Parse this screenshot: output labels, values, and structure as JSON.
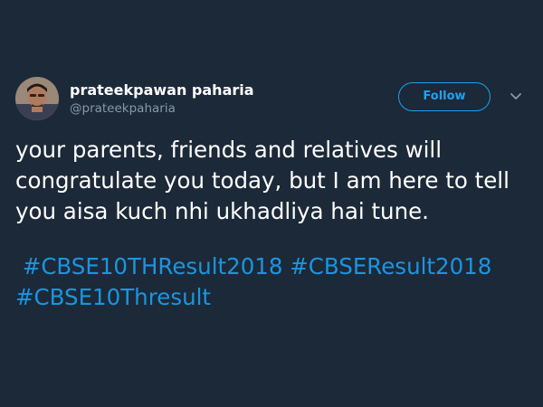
{
  "user": {
    "display_name": "prateekpawan paharia",
    "handle": "@prateekpaharia",
    "avatar_icon": "user-avatar"
  },
  "actions": {
    "follow_label": "Follow",
    "more_icon": "chevron-down-icon"
  },
  "tweet": {
    "lines": [
      "your parents, friends and relatives will",
      "congratulate you today, but I am here to tell",
      "you aisa kuch nhi ukhadliya hai tune."
    ],
    "hashtags": [
      "#CBSE10THResult2018",
      "#CBSEResult2018",
      "#CBSE10Thresult"
    ]
  },
  "colors": {
    "background": "#1c2938",
    "accent": "#1da1f2",
    "secondary_text": "#8899a6",
    "hashtag": "#1b95e0"
  }
}
